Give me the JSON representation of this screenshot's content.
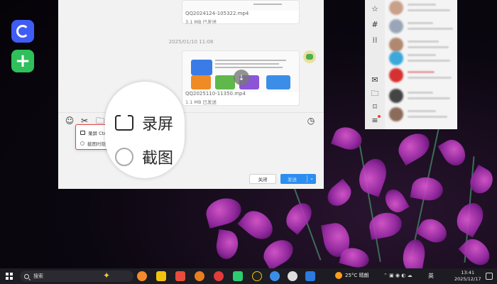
{
  "chat": {
    "file1_name": "QQ2024124-105322.mp4",
    "file1_size": "3.1 MB 已发送",
    "timestamp": "2025/01/10 11:08",
    "file2_name": "QQ2025110-11350.mp4",
    "file2_size": "1.1 MB 已发送",
    "close_label": "关闭",
    "send_label": "发送"
  },
  "popup": {
    "item_record": "录屏 Ctrl",
    "item_screenshot": "截图时隐"
  },
  "magnifier": {
    "item_record": "录屏",
    "item_screenshot": "截图"
  },
  "taskbar": {
    "search_placeholder": "搜索",
    "weather": "25°C 晴朗",
    "ime": "英",
    "time": "13:41",
    "date": "2025/12/17"
  },
  "colors": {
    "accent_blue": "#2b8ef0",
    "highlight_red": "#e04545"
  }
}
